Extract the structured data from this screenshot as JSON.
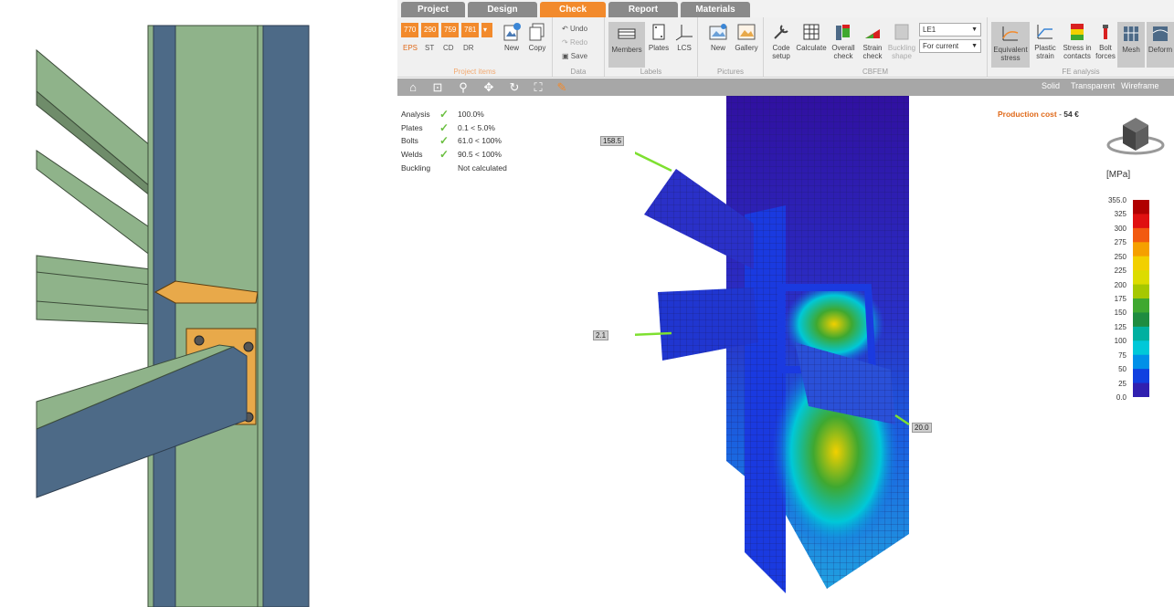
{
  "tabs": [
    {
      "label": "Project",
      "active": false
    },
    {
      "label": "Design",
      "active": false
    },
    {
      "label": "Check",
      "active": true
    },
    {
      "label": "Report",
      "active": false
    },
    {
      "label": "Materials",
      "active": false
    }
  ],
  "ribbon": {
    "project_items": {
      "status_values": [
        "770",
        "290",
        "759",
        "781"
      ],
      "checks": [
        "EPS",
        "ST",
        "CD",
        "DR"
      ],
      "new_label": "New",
      "copy_label": "Copy",
      "group_label": "Project items"
    },
    "data": {
      "undo": "Undo",
      "redo": "Redo",
      "save": "Save",
      "group_label": "Data"
    },
    "labels": {
      "members": "Members",
      "plates": "Plates",
      "lcs": "LCS",
      "group_label": "Labels"
    },
    "pictures": {
      "new": "New",
      "gallery": "Gallery",
      "group_label": "Pictures"
    },
    "cbfem": {
      "code_setup": "Code setup",
      "calculate": "Calculate",
      "overall_check": "Overall check",
      "strain_check": "Strain check",
      "buckling_shape": "Buckling shape",
      "load_case_select": "LE1",
      "scope_select": "For current",
      "group_label": "CBFEM"
    },
    "fe_analysis": {
      "equivalent_stress": "Equivalent stress",
      "plastic_strain": "Plastic strain",
      "stress_in_contacts": "Stress in contacts",
      "bolt_forces": "Bolt forces",
      "mesh": "Mesh",
      "deformed": "Deform",
      "group_label": "FE analysis"
    }
  },
  "toolbar": {
    "view_modes": [
      "Solid",
      "Transparent",
      "Wireframe"
    ]
  },
  "results": [
    {
      "label": "Analysis",
      "check": true,
      "value": "100.0%"
    },
    {
      "label": "Plates",
      "check": true,
      "value": "0.1 < 5.0%"
    },
    {
      "label": "Bolts",
      "check": true,
      "value": "61.0 < 100%"
    },
    {
      "label": "Welds",
      "check": true,
      "value": "90.5 < 100%"
    },
    {
      "label": "Buckling",
      "check": false,
      "value": "Not calculated"
    }
  ],
  "production_cost": {
    "label": "Production cost",
    "sep": "-",
    "value": "54 €"
  },
  "legend": {
    "unit": "[MPa]",
    "ticks": [
      "355.0",
      "325",
      "300",
      "275",
      "250",
      "225",
      "200",
      "175",
      "150",
      "125",
      "100",
      "75",
      "50",
      "25",
      "0.0"
    ],
    "colors": [
      "#b00000",
      "#e01010",
      "#f25a10",
      "#f5a000",
      "#f2d000",
      "#dcdc00",
      "#a6c800",
      "#3fa830",
      "#1e8c40",
      "#00b0a0",
      "#00c8d8",
      "#0090e8",
      "#1040e0",
      "#3020b0"
    ]
  },
  "force_labels": [
    "158.5",
    "2.1",
    "20.0"
  ],
  "colors": {
    "accent": "#f28a2c",
    "tab_inactive": "#8a8a8a",
    "toolbar": "#a7a7a7",
    "steel_green": "#8fb38a",
    "steel_blue": "#4d6a87",
    "plate_orange": "#e8a94a"
  }
}
